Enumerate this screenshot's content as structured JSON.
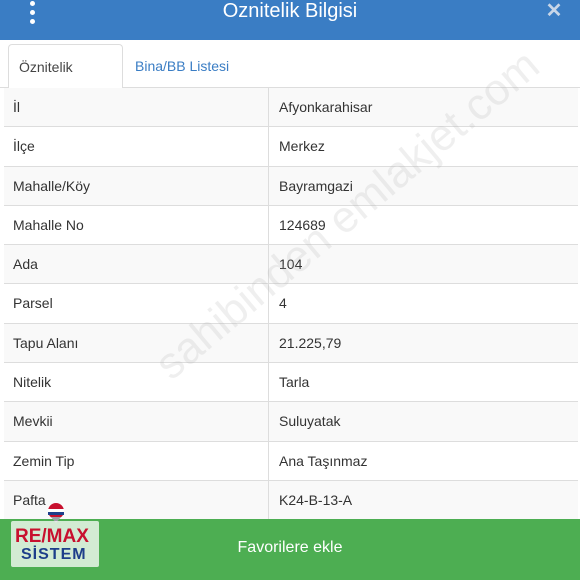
{
  "window": {
    "title": "Oznitelik Bilgisi"
  },
  "tabs": [
    {
      "label": "Öznitelik Bilgisi",
      "active": true
    },
    {
      "label": "Bina/BB Listesi",
      "active": false
    }
  ],
  "rows": [
    {
      "key": "İl",
      "value": "Afyonkarahisar"
    },
    {
      "key": "İlçe",
      "value": "Merkez"
    },
    {
      "key": "Mahalle/Köy",
      "value": "Bayramgazi"
    },
    {
      "key": "Mahalle No",
      "value": "124689"
    },
    {
      "key": "Ada",
      "value": "104"
    },
    {
      "key": "Parsel",
      "value": "4"
    },
    {
      "key": "Tapu Alanı",
      "value": "21.225,79"
    },
    {
      "key": "Nitelik",
      "value": "Tarla"
    },
    {
      "key": "Mevkii",
      "value": "Suluyatak"
    },
    {
      "key": "Zemin Tip",
      "value": "Ana Taşınmaz"
    },
    {
      "key": "Pafta",
      "value": "K24-B-13-A"
    }
  ],
  "footer": {
    "button_label": "Favorilere ekle"
  },
  "watermark": "sahibinden emlakjet.com",
  "logo": {
    "brand": "RE/MAX",
    "sub": "SİSTEM"
  },
  "colors": {
    "header": "#3a7dc4",
    "footer": "#4dae52",
    "link": "#3a7dc4"
  },
  "icons": {
    "menu": "kebab-menu-icon",
    "close": "close-icon",
    "balloon": "balloon-icon"
  }
}
